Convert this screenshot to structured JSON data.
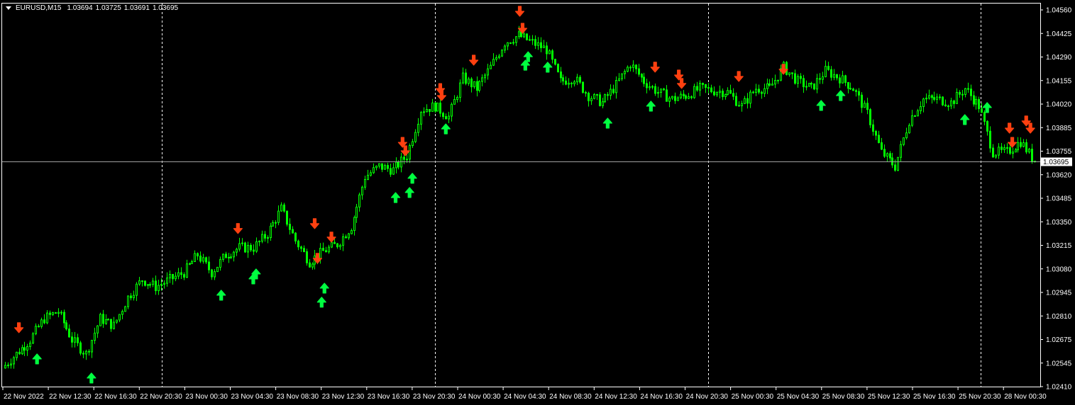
{
  "header": {
    "symbol": "EURUSD,M15",
    "open": "1.03694",
    "high": "1.03725",
    "low": "1.03691",
    "close": "1.03695"
  },
  "colors": {
    "background": "#000000",
    "candle": "#00ff00",
    "sell_arrow": "#ff4010",
    "buy_arrow": "#00ff40",
    "grid_separator": "#ffffff",
    "price_line": "#a0a0a0"
  },
  "chart_data": {
    "type": "candlestick",
    "title": "EURUSD,M15",
    "ylim": [
      1.0241,
      1.0456
    ],
    "y_ticks": [
      "1.04560",
      "1.04425",
      "1.04290",
      "1.04155",
      "1.04020",
      "1.03885",
      "1.03755",
      "1.03620",
      "1.03485",
      "1.03350",
      "1.03215",
      "1.03080",
      "1.02945",
      "1.02810",
      "1.02675",
      "1.02545",
      "1.02410"
    ],
    "x_ticks": [
      "22 Nov 2022",
      "22 Nov 12:30",
      "22 Nov 16:30",
      "22 Nov 20:30",
      "23 Nov 00:30",
      "23 Nov 04:30",
      "23 Nov 08:30",
      "23 Nov 12:30",
      "23 Nov 16:30",
      "23 Nov 20:30",
      "24 Nov 00:30",
      "24 Nov 04:30",
      "24 Nov 08:30",
      "24 Nov 12:30",
      "24 Nov 16:30",
      "24 Nov 20:30",
      "25 Nov 00:30",
      "25 Nov 04:30",
      "25 Nov 08:30",
      "25 Nov 12:30",
      "25 Nov 16:30",
      "25 Nov 20:30",
      "28 Nov 00:30"
    ],
    "current_price": 1.03695,
    "current_price_label": "1.03695",
    "day_separators_at_tick": [
      3.5,
      9.5,
      15.5,
      21.5
    ],
    "price_path": [
      1.02516,
      1.02597,
      1.02677,
      1.02799,
      1.02839,
      1.02677,
      1.02597,
      1.02799,
      1.02758,
      1.0292,
      1.03021,
      1.0298,
      1.03021,
      1.03061,
      1.03162,
      1.03061,
      1.03162,
      1.03203,
      1.03203,
      1.03283,
      1.03425,
      1.03243,
      1.03122,
      1.03182,
      1.03223,
      1.03324,
      1.03607,
      1.03667,
      1.03647,
      1.03728,
      1.0399,
      1.04011,
      1.0395,
      1.04172,
      1.04112,
      1.04233,
      1.04374,
      1.04415,
      1.04374,
      1.04334,
      1.04152,
      1.04172,
      1.04071,
      1.04031,
      1.04132,
      1.04253,
      1.04152,
      1.04091,
      1.04051,
      1.04071,
      1.04112,
      1.04099,
      1.04091,
      1.04011,
      1.04112,
      1.04112,
      1.04233,
      1.04152,
      1.04112,
      1.04213,
      1.04172,
      1.04112,
      1.0397,
      1.03748,
      1.03667,
      1.0393,
      1.04051,
      1.04051,
      1.04031,
      1.04112,
      1.04011,
      1.03748,
      1.03748,
      1.03809,
      1.03695
    ],
    "signals": [
      {
        "type": "sell",
        "i": 1.1,
        "price": 1.02738
      },
      {
        "type": "sell",
        "i": 16.8,
        "price": 1.03304
      },
      {
        "type": "sell",
        "i": 22.3,
        "price": 1.03332
      },
      {
        "type": "sell",
        "i": 23.5,
        "price": 1.03255
      },
      {
        "type": "sell",
        "i": 22.5,
        "price": 1.03134
      },
      {
        "type": "sell",
        "i": 28.6,
        "price": 1.03796
      },
      {
        "type": "sell",
        "i": 28.8,
        "price": 1.03748
      },
      {
        "type": "sell",
        "i": 31.3,
        "price": 1.04103
      },
      {
        "type": "sell",
        "i": 31.4,
        "price": 1.04063
      },
      {
        "type": "sell",
        "i": 33.7,
        "price": 1.04265
      },
      {
        "type": "sell",
        "i": 37.0,
        "price": 1.04544
      },
      {
        "type": "sell",
        "i": 37.2,
        "price": 1.04447
      },
      {
        "type": "sell",
        "i": 46.7,
        "price": 1.04225
      },
      {
        "type": "sell",
        "i": 48.4,
        "price": 1.0418
      },
      {
        "type": "sell",
        "i": 48.6,
        "price": 1.04132
      },
      {
        "type": "sell",
        "i": 52.7,
        "price": 1.04172
      },
      {
        "type": "sell",
        "i": 55.9,
        "price": 1.04213
      },
      {
        "type": "sell",
        "i": 72.1,
        "price": 1.03877
      },
      {
        "type": "sell",
        "i": 72.3,
        "price": 1.03796
      },
      {
        "type": "sell",
        "i": 73.3,
        "price": 1.03918
      },
      {
        "type": "sell",
        "i": 73.6,
        "price": 1.03877
      },
      {
        "type": "buy",
        "i": 2.4,
        "price": 1.02576
      },
      {
        "type": "buy",
        "i": 6.3,
        "price": 1.02467
      },
      {
        "type": "buy",
        "i": 15.6,
        "price": 1.0294
      },
      {
        "type": "buy",
        "i": 17.9,
        "price": 1.03033
      },
      {
        "type": "buy",
        "i": 18.1,
        "price": 1.03061
      },
      {
        "type": "buy",
        "i": 22.8,
        "price": 1.029
      },
      {
        "type": "buy",
        "i": 23.0,
        "price": 1.0298
      },
      {
        "type": "buy",
        "i": 28.1,
        "price": 1.03497
      },
      {
        "type": "buy",
        "i": 29.1,
        "price": 1.03526
      },
      {
        "type": "buy",
        "i": 29.3,
        "price": 1.03607
      },
      {
        "type": "buy",
        "i": 31.7,
        "price": 1.03889
      },
      {
        "type": "buy",
        "i": 37.4,
        "price": 1.04253
      },
      {
        "type": "buy",
        "i": 37.6,
        "price": 1.04301
      },
      {
        "type": "buy",
        "i": 39.0,
        "price": 1.04241
      },
      {
        "type": "buy",
        "i": 43.3,
        "price": 1.03922
      },
      {
        "type": "buy",
        "i": 46.4,
        "price": 1.04019
      },
      {
        "type": "buy",
        "i": 58.6,
        "price": 1.04023
      },
      {
        "type": "buy",
        "i": 60.0,
        "price": 1.04079
      },
      {
        "type": "buy",
        "i": 68.9,
        "price": 1.03942
      },
      {
        "type": "buy",
        "i": 70.5,
        "price": 1.04011
      }
    ]
  }
}
